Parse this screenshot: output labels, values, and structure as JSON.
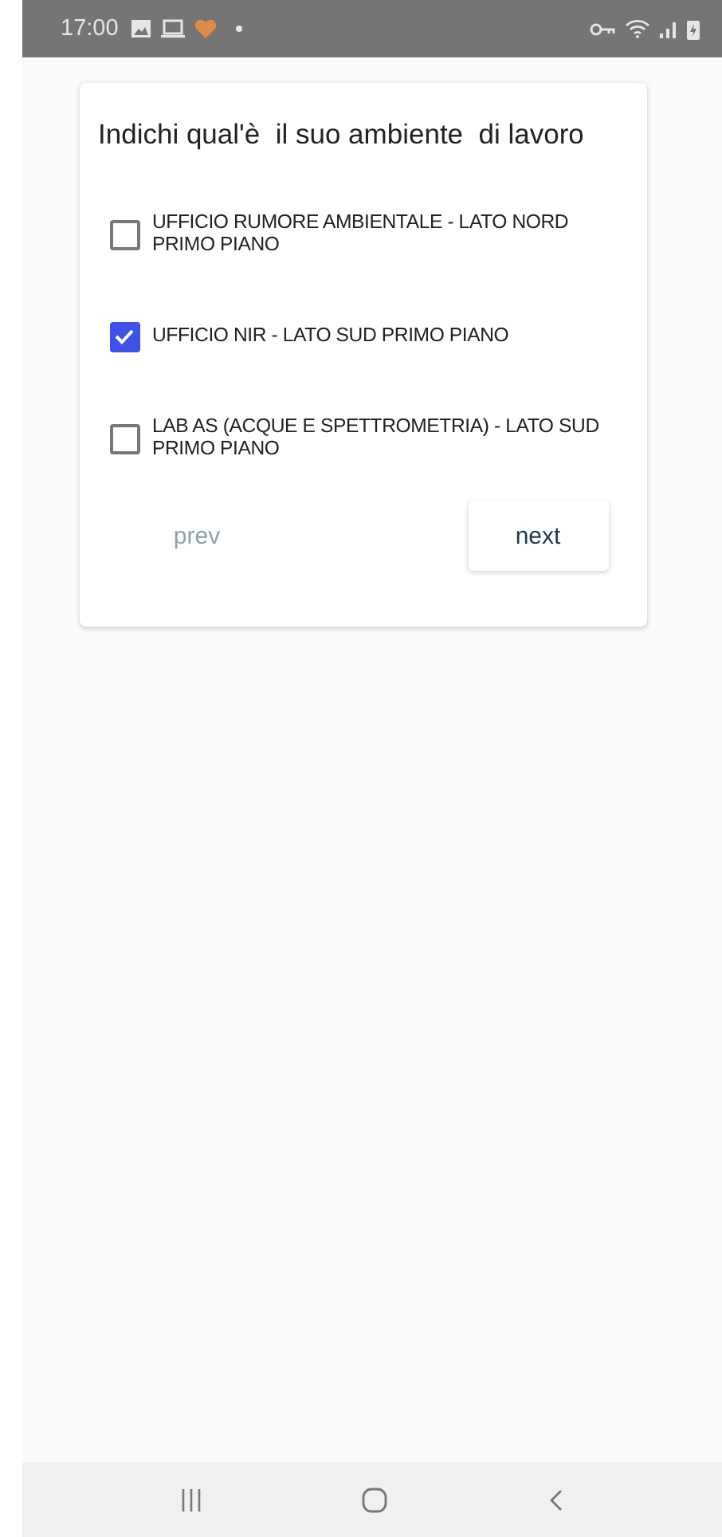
{
  "status_bar": {
    "time": "17:00"
  },
  "question": {
    "title": "Indichi qual'è  il suo ambiente  di lavoro",
    "options": [
      {
        "label": "UFFICIO RUMORE AMBIENTALE - LATO NORD PRIMO PIANO",
        "checked": false
      },
      {
        "label": "UFFICIO NIR - LATO SUD PRIMO PIANO",
        "checked": true
      },
      {
        "label": "LAB AS (ACQUE E SPETTROMETRIA) - LATO SUD PRIMO PIANO",
        "checked": false
      }
    ],
    "buttons": [
      {
        "label": "prev",
        "disabled": true
      },
      {
        "label": "next",
        "disabled": false
      }
    ]
  }
}
